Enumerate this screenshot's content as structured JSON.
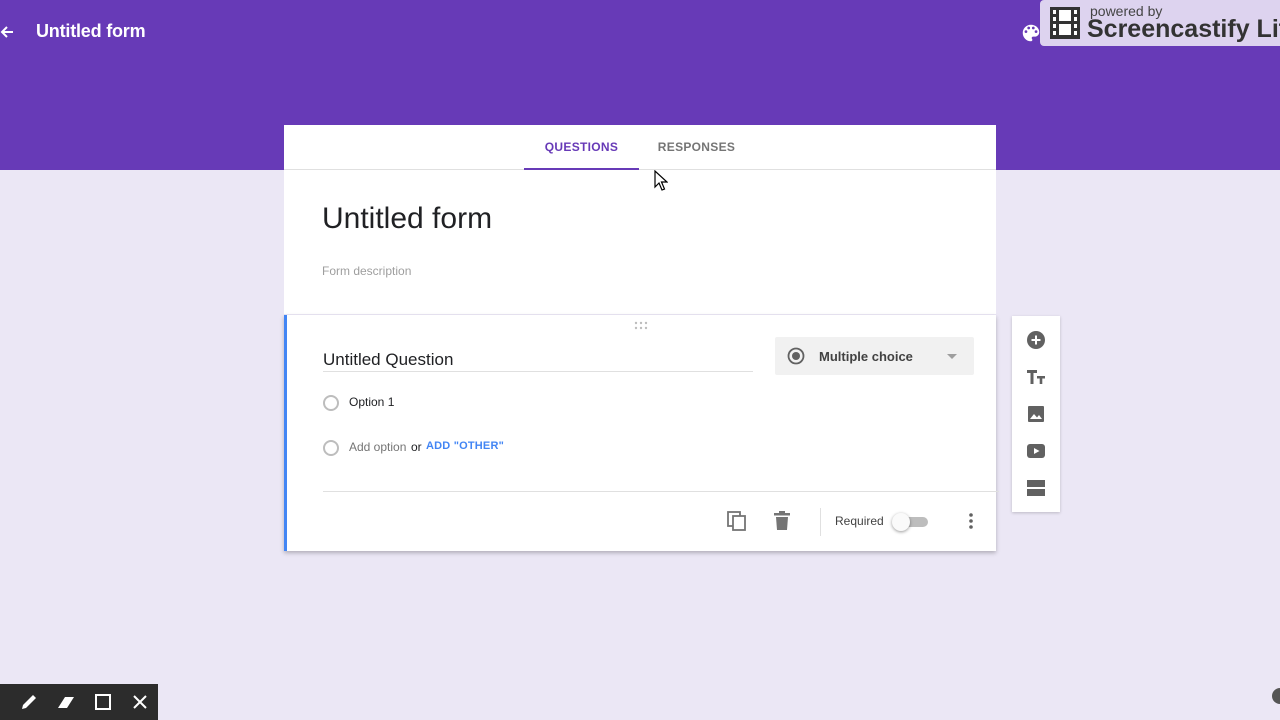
{
  "header": {
    "title": "Untitled form",
    "back_icon": "arrow-back-icon",
    "palette_icon": "palette-icon",
    "color": "#673ab7"
  },
  "watermark": {
    "line1": "powered by",
    "line2": "Screencastify Lit"
  },
  "tabs": [
    {
      "label": "QUESTIONS",
      "active": true
    },
    {
      "label": "RESPONSES",
      "active": false
    }
  ],
  "form": {
    "title": "Untitled form",
    "description_placeholder": "Form description"
  },
  "question": {
    "title": "Untitled Question",
    "type": "Multiple choice",
    "options": [
      "Option 1"
    ],
    "add_option": "Add option",
    "or_text": "or",
    "add_other": "ADD \"OTHER\"",
    "required_label": "Required",
    "required": false,
    "accent_color": "#4285f4"
  },
  "side_toolbar": {
    "icons": [
      "add-question-icon",
      "add-title-icon",
      "add-image-icon",
      "add-video-icon",
      "add-section-icon"
    ]
  },
  "annotation_tools": {
    "icons": [
      "pen-icon",
      "highlighter-icon",
      "rectangle-icon",
      "close-icon"
    ]
  }
}
